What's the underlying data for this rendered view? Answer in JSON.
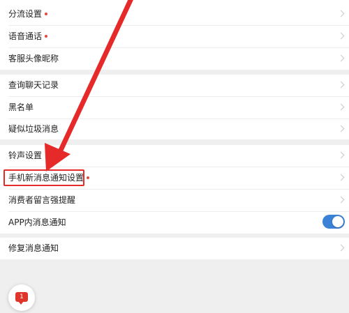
{
  "settings": {
    "group1": [
      {
        "label": "分流设置",
        "marked": true
      },
      {
        "label": "语音通话",
        "marked": true
      },
      {
        "label": "客服头像昵称",
        "marked": false
      }
    ],
    "group2": [
      {
        "label": "查询聊天记录"
      },
      {
        "label": "黑名单"
      },
      {
        "label": "疑似垃圾消息"
      }
    ],
    "group3": [
      {
        "label": "铃声设置"
      },
      {
        "label": "手机新消息通知设置",
        "marked": true
      },
      {
        "label": "消费者留言强提醒"
      },
      {
        "label": "APP内消息通知",
        "toggle": true,
        "toggle_on": true
      }
    ],
    "group4": [
      {
        "label": "修复消息通知"
      }
    ]
  },
  "fab": {
    "badge": "1"
  },
  "colors": {
    "accent_red": "#e62a2a",
    "toggle_blue": "#3b82d6",
    "marker_dot": "#e04a3a"
  }
}
